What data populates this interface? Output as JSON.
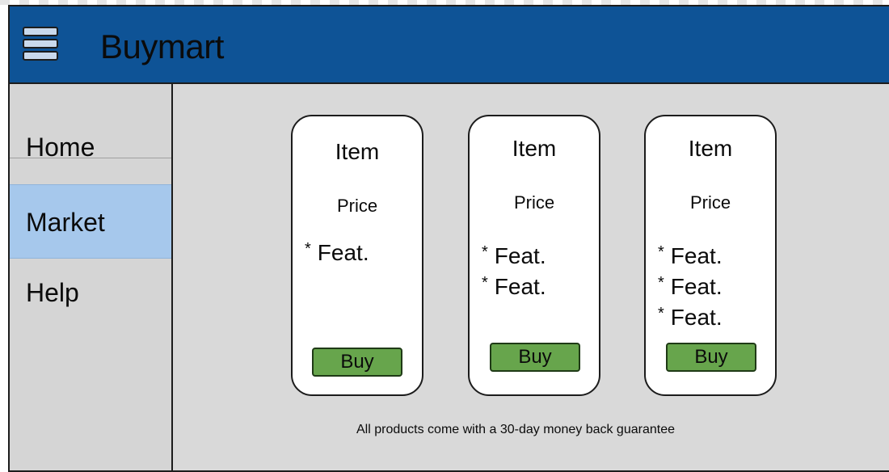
{
  "app": {
    "title": "Buymart"
  },
  "colors": {
    "brand": "#0e5396",
    "active_nav": "#a6c8ec",
    "buy_button": "#67a54c",
    "content_bg": "#d9d9d9"
  },
  "header": {
    "menu_icon": "hamburger-menu-icon"
  },
  "sidebar": {
    "items": [
      {
        "label": "Home",
        "active": false
      },
      {
        "label": "Market",
        "active": true
      },
      {
        "label": "Help",
        "active": false
      }
    ]
  },
  "products": [
    {
      "title": "Item",
      "price": "Price",
      "features": [
        "Feat."
      ],
      "buy_label": "Buy"
    },
    {
      "title": "Item",
      "price": "Price",
      "features": [
        "Feat.",
        "Feat."
      ],
      "buy_label": "Buy"
    },
    {
      "title": "Item",
      "price": "Price",
      "features": [
        "Feat.",
        "Feat.",
        "Feat."
      ],
      "buy_label": "Buy"
    }
  ],
  "feature_bullet": "*",
  "footer_note": "All products come with a 30-day money back guarantee"
}
